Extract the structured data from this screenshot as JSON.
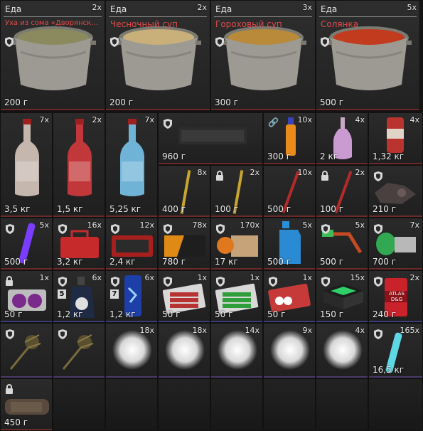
{
  "colors": {
    "name_red": "#e24a4a",
    "row_underline": "#6d2a2a",
    "cell_bg": "#252525"
  },
  "soups": [
    {
      "category": "Еда",
      "count": "2x",
      "name": "Уха из сома «Дворянск…",
      "weight": "200 г",
      "protected": true,
      "broth": "#8b8a5e"
    },
    {
      "category": "Еда",
      "count": "2x",
      "name": "Чесночный суп",
      "weight": "200 г",
      "protected": true,
      "broth": "#c9b07a"
    },
    {
      "category": "Еда",
      "count": "3x",
      "name": "Гороховый суп",
      "weight": "300 г",
      "protected": true,
      "broth": "#b88a3a"
    },
    {
      "category": "Еда",
      "count": "5x",
      "name": "Солянка",
      "weight": "500 г",
      "protected": true,
      "broth": "#c23b1e"
    }
  ],
  "items": [
    {
      "id": "red-wine-bottle",
      "count": "7x",
      "weight": "3,5 кг"
    },
    {
      "id": "red-bottle-ruse",
      "count": "2x",
      "weight": "1,5 кг"
    },
    {
      "id": "blue-bottle",
      "count": "7x",
      "weight": "5,25 кг"
    },
    {
      "id": "silencer",
      "count": "",
      "weight": "960 г",
      "protected": true
    },
    {
      "id": "orange-injector",
      "count": "10x",
      "weight": "300 г",
      "linked": true
    },
    {
      "id": "pink-bottle",
      "count": "4x",
      "weight": "2 кг"
    },
    {
      "id": "soda-can",
      "count": "4x",
      "weight": "1,32 кг"
    },
    {
      "id": "yellow-rod",
      "count": "8x",
      "weight": "400 г"
    },
    {
      "id": "yellow-rod-locked",
      "count": "2x",
      "weight": "100 г",
      "locked": true
    },
    {
      "id": "red-rod",
      "count": "10x",
      "weight": "500 г"
    },
    {
      "id": "red-rod-locked",
      "count": "2x",
      "weight": "100 г",
      "locked": true
    },
    {
      "id": "scrap-parts",
      "count": "",
      "weight": "210 г",
      "protected": true
    },
    {
      "id": "purple-glowstick",
      "count": "5x",
      "weight": "500 г",
      "protected": true
    },
    {
      "id": "red-toolbox",
      "count": "16x",
      "weight": "3,2 кг",
      "protected": true
    },
    {
      "id": "red-case",
      "count": "12x",
      "weight": "2,4 кг",
      "protected": true
    },
    {
      "id": "orange-black-box",
      "count": "78x",
      "weight": "780 г",
      "protected": true
    },
    {
      "id": "orange-ammo-box",
      "count": "170x",
      "weight": "17 кг",
      "protected": true
    },
    {
      "id": "blue-canister",
      "count": "5x",
      "weight": "500 г"
    },
    {
      "id": "green-tool",
      "count": "5x",
      "weight": "500 г",
      "protected": true
    },
    {
      "id": "green-spool",
      "count": "7x",
      "weight": "700 г",
      "protected": true
    },
    {
      "id": "purple-orbs",
      "count": "1x",
      "weight": "50 г",
      "locked": true
    },
    {
      "id": "grenade-dark",
      "count": "6x",
      "weight": "1,2 кг",
      "protected": true,
      "level": "5"
    },
    {
      "id": "energy-can",
      "count": "6x",
      "weight": "1,2 кг",
      "protected": true,
      "level": "7"
    },
    {
      "id": "battery-pack-red",
      "count": "1x",
      "weight": "50 г",
      "protected": true
    },
    {
      "id": "battery-pack-green",
      "count": "1x",
      "weight": "50 г",
      "protected": true
    },
    {
      "id": "stick-pack",
      "count": "1x",
      "weight": "50 г",
      "protected": true
    },
    {
      "id": "green-black-case",
      "count": "15x",
      "weight": "150 г",
      "protected": true
    },
    {
      "id": "atlas-can",
      "count": "2x",
      "weight": "240 г",
      "protected": true,
      "label": "ATLAS D&G"
    },
    {
      "id": "dried-plant-a",
      "count": "",
      "weight": "",
      "protected": true
    },
    {
      "id": "dried-plant-b",
      "count": "",
      "weight": "",
      "protected": true
    },
    {
      "id": "white-cloud-1",
      "count": "18x",
      "weight": ""
    },
    {
      "id": "white-cloud-2",
      "count": "18x",
      "weight": ""
    },
    {
      "id": "white-cloud-3",
      "count": "14x",
      "weight": ""
    },
    {
      "id": "white-cloud-4",
      "count": "9x",
      "weight": ""
    },
    {
      "id": "white-cloud-5",
      "count": "4x",
      "weight": ""
    },
    {
      "id": "cyan-glowstick",
      "count": "165x",
      "weight": "16,5 кг",
      "protected": true
    },
    {
      "id": "rusty-pipe",
      "count": "",
      "weight": "450 г",
      "locked": true
    }
  ]
}
